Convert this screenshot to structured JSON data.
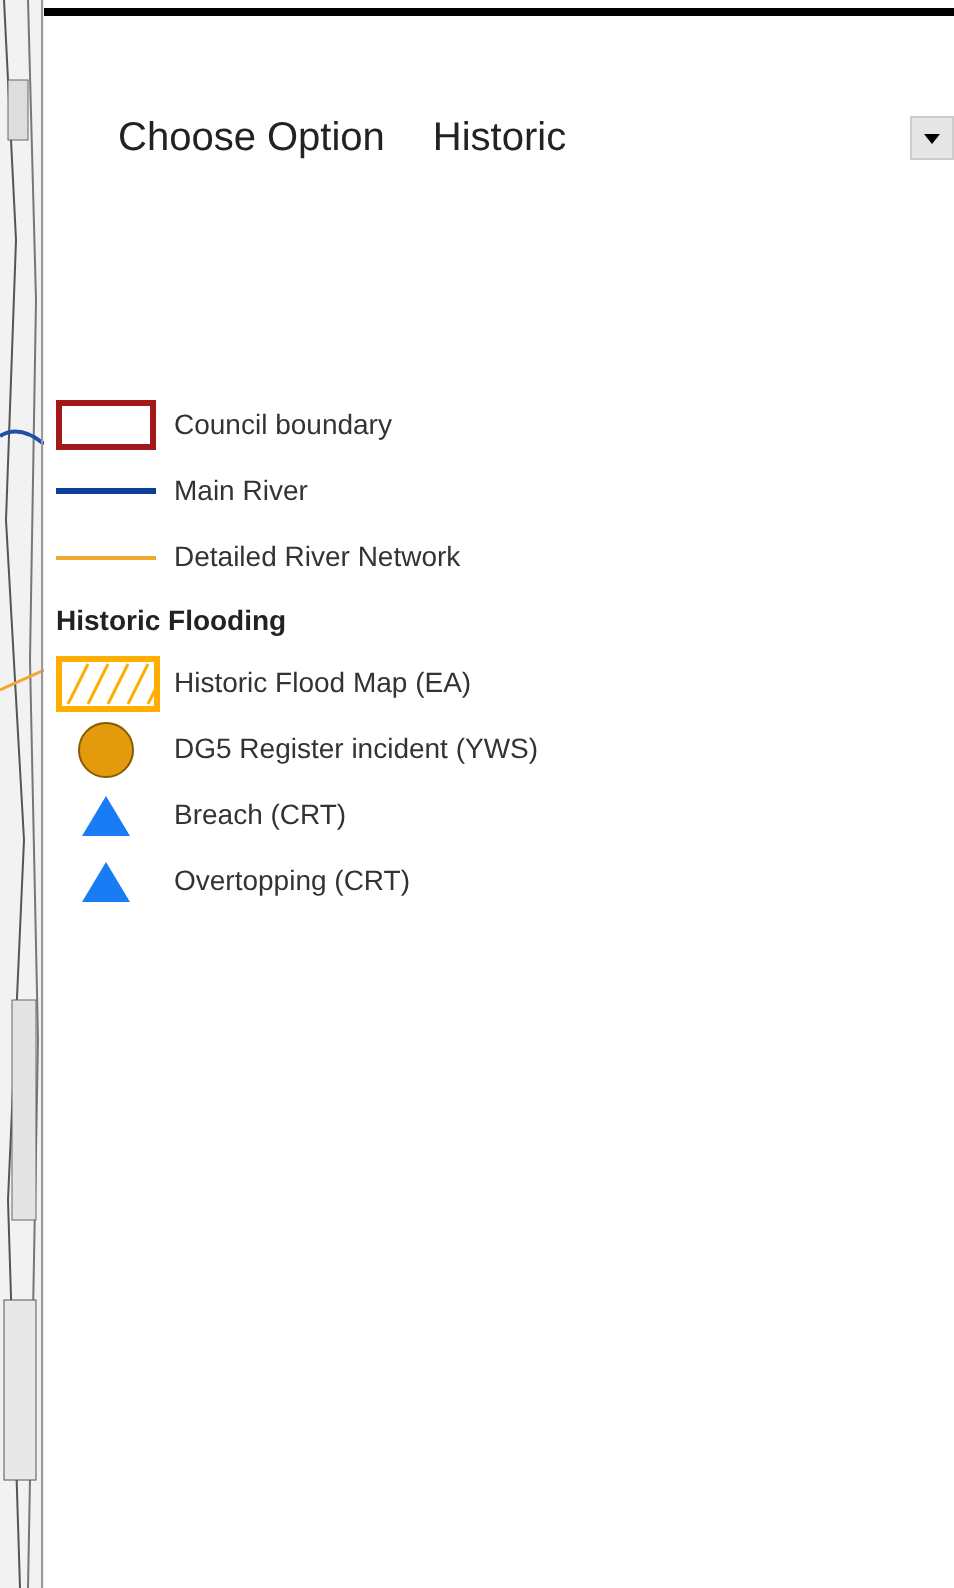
{
  "selector": {
    "label": "Choose Option",
    "value": "Historic"
  },
  "legend": [
    {
      "kind": "box",
      "label": "Council boundary",
      "color": "#a31919"
    },
    {
      "kind": "line",
      "label": "Main River",
      "color": "#0a3f9c"
    },
    {
      "kind": "thin",
      "label": "Detailed River Network",
      "color": "#f0a830"
    },
    {
      "kind": "heading",
      "label": "Historic Flooding"
    },
    {
      "kind": "hatch",
      "label": "Historic Flood Map (EA)",
      "color": "#ffae00"
    },
    {
      "kind": "circle",
      "label": "DG5 Register incident (YWS)",
      "color": "#e39a0c"
    },
    {
      "kind": "triangle",
      "label": "Breach (CRT)",
      "color": "#1a7cf5"
    },
    {
      "kind": "triangle",
      "label": "Overtopping (CRT)",
      "color": "#1a7cf5"
    }
  ]
}
